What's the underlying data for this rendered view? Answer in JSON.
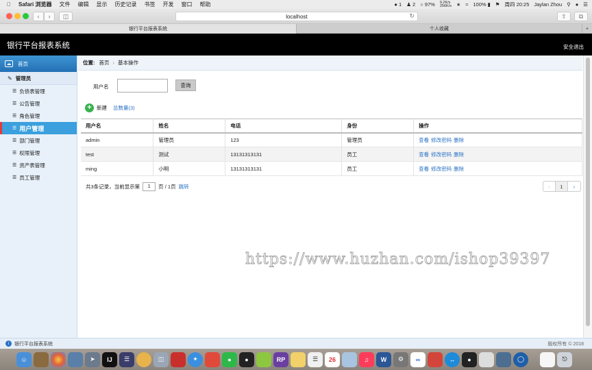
{
  "menubar": {
    "apple": "",
    "app_name": "Safari 浏览器",
    "menus": [
      "文件",
      "编辑",
      "显示",
      "历史记录",
      "书签",
      "开发",
      "窗口",
      "帮助"
    ],
    "status": {
      "wechat_badge": "1",
      "people_badge": "2",
      "cpu": "97%",
      "net_up": "9.2K/s",
      "net_down": "256K/s",
      "battery": "100%",
      "datetime": "周四 20:25",
      "user": "Jaylan Zhou"
    }
  },
  "browser": {
    "url": "localhost",
    "tabs": [
      {
        "label": "银行平台报表系统",
        "active": true
      },
      {
        "label": "个人收藏",
        "active": false
      }
    ]
  },
  "app": {
    "title": "银行平台报表系统",
    "logout": "安全退出"
  },
  "sidebar": {
    "home": "首页",
    "group": "管理员",
    "items": [
      {
        "label": "负债表管理",
        "active": false
      },
      {
        "label": "公告管理",
        "active": false
      },
      {
        "label": "角色管理",
        "active": false
      },
      {
        "label": "用户管理",
        "active": true
      },
      {
        "label": "部门管理",
        "active": false
      },
      {
        "label": "权限管理",
        "active": false
      },
      {
        "label": "资产表管理",
        "active": false
      },
      {
        "label": "员工管理",
        "active": false
      }
    ]
  },
  "breadcrumb": {
    "prefix": "位置:",
    "items": [
      "首页",
      "基本操作"
    ]
  },
  "search": {
    "label": "用户名",
    "value": "",
    "button": "查询"
  },
  "actions": {
    "new_label": "新建",
    "total_label": "总数量(3)"
  },
  "table": {
    "headers": [
      "用户名",
      "姓名",
      "电话",
      "身份",
      "操作"
    ],
    "rows": [
      {
        "username": "admin",
        "name": "管理员",
        "phone": "123",
        "role": "管理员"
      },
      {
        "username": "test",
        "name": "测试",
        "phone": "13131313131",
        "role": "员工"
      },
      {
        "username": "ming",
        "name": "小明",
        "phone": "13131313131",
        "role": "员工"
      }
    ],
    "ops": [
      "查看",
      "修改密码",
      "删除"
    ]
  },
  "pagination": {
    "summary": "共3条记录，当前显示第",
    "current_page": "1",
    "page_suffix": "页 / 1页",
    "jump": "跳转",
    "prev": "‹",
    "page": "1",
    "next": "›"
  },
  "watermark": "https://www.huzhan.com/ishop39397",
  "footer": {
    "text": "银行平台报表系统",
    "copyright": "版权所有 © 2018"
  },
  "colors": {
    "header_bg": "#000000",
    "sidebar_active": "#3ba0dd",
    "link": "#2a72c4",
    "new_button": "#37b24d"
  }
}
